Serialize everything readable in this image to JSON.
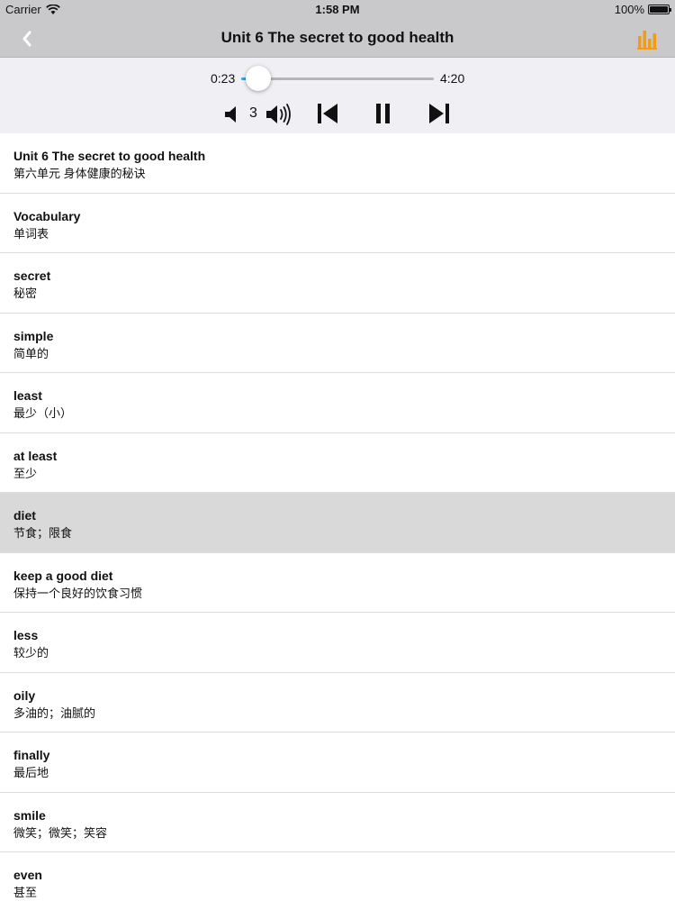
{
  "status": {
    "carrier": "Carrier",
    "time": "1:58 PM",
    "battery": "100%"
  },
  "nav": {
    "title": "Unit 6 The secret to good health",
    "back_icon": "chevron-left-icon",
    "eq_icon": "equalizer-icon",
    "accent": "#f39c12"
  },
  "player": {
    "current_time": "0:23",
    "total_time": "4:20",
    "progress": 0.088,
    "volume_level": "3",
    "played_color": "#3ea2dc",
    "state": "playing"
  },
  "list": {
    "selected_index": 6,
    "items": [
      {
        "en": "Unit 6 The secret to good health",
        "zh": "第六单元 身体健康的秘诀"
      },
      {
        "en": "Vocabulary",
        "zh": "单词表"
      },
      {
        "en": "secret",
        "zh": "秘密"
      },
      {
        "en": "simple",
        "zh": "简单的"
      },
      {
        "en": "least",
        "zh": "最少（小）"
      },
      {
        "en": "at least",
        "zh": "至少"
      },
      {
        "en": "diet",
        "zh": "节食；限食"
      },
      {
        "en": "keep a good diet",
        "zh": "保持一个良好的饮食习惯"
      },
      {
        "en": "less",
        "zh": "较少的"
      },
      {
        "en": "oily",
        "zh": "多油的；油腻的"
      },
      {
        "en": "finally",
        "zh": "最后地"
      },
      {
        "en": "smile",
        "zh": "微笑；微笑；笑容"
      },
      {
        "en": "even",
        "zh": "甚至"
      }
    ]
  }
}
